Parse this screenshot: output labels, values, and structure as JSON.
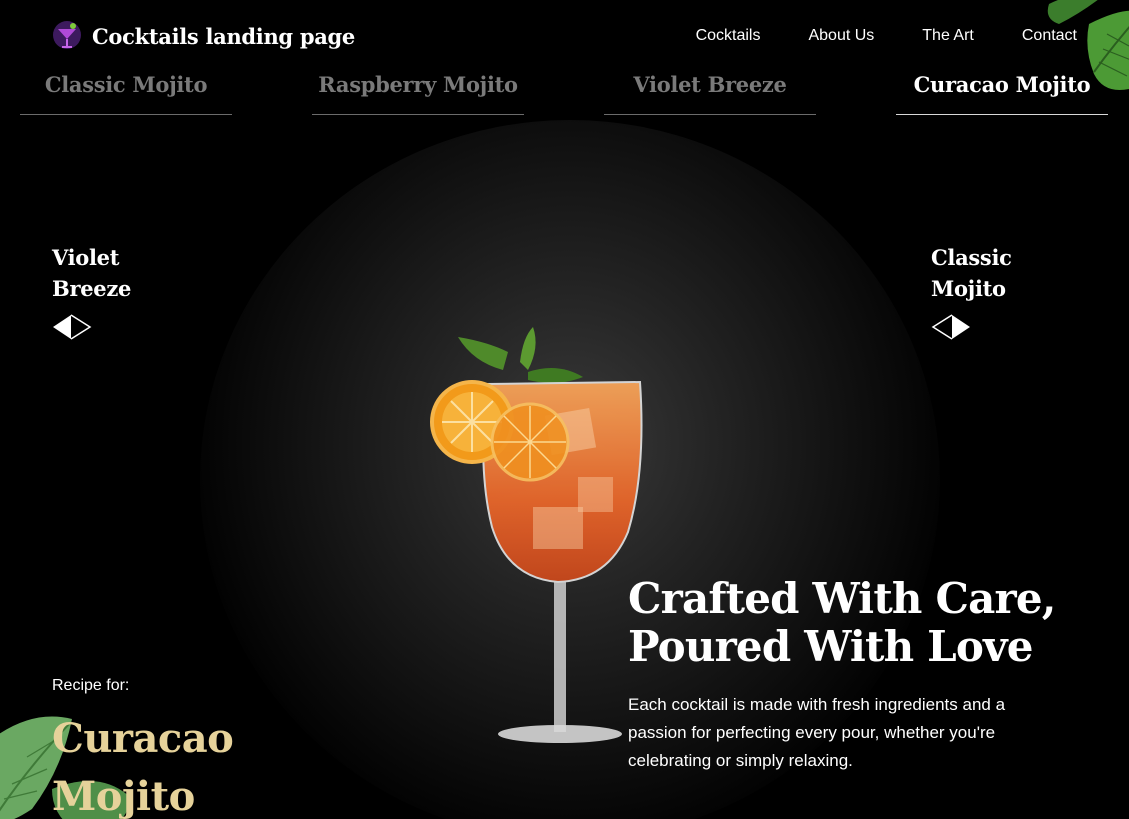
{
  "brand": {
    "name": "Cocktails landing page",
    "logo_icon": "cocktail-logo-icon"
  },
  "nav": {
    "items": [
      "Cocktails",
      "About Us",
      "The Art",
      "Contact"
    ]
  },
  "tabs": [
    {
      "label": "Classic Mojito",
      "active": false
    },
    {
      "label": "Raspberry Mojito",
      "active": false
    },
    {
      "label": "Violet Breeze",
      "active": false
    },
    {
      "label": "Curacao Mojito",
      "active": true
    }
  ],
  "prev": {
    "label_line1": "Violet",
    "label_line2": "Breeze",
    "icon": "arrow-left-icon"
  },
  "next": {
    "label_line1": "Classic",
    "label_line2": "Mojito",
    "icon": "arrow-right-icon"
  },
  "hero": {
    "heading_line1": "Crafted With Care,",
    "heading_line2": "Poured With Love",
    "description": "Each cocktail is made with fresh ingredients and a passion for perfecting every pour, whether you're celebrating or simply relaxing."
  },
  "recipe": {
    "label": "Recipe for:",
    "name_line1": "Curacao",
    "name_line2": "Mojito"
  },
  "colors": {
    "background": "#000000",
    "accent": "#e6d29a",
    "inactive_tab": "#7a7a7a",
    "leaf": "#2f7a2c"
  }
}
